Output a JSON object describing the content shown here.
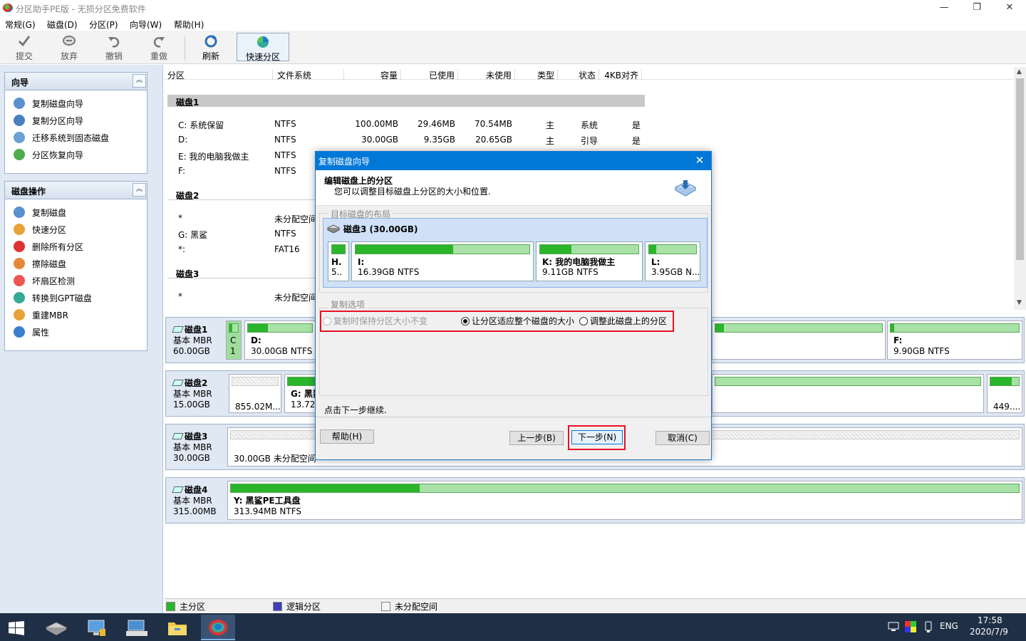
{
  "window": {
    "title": "分区助手PE版 - 无损分区免费软件",
    "minimize": "—",
    "maximize": "❐",
    "close": "✕"
  },
  "menu": [
    "常规(G)",
    "磁盘(D)",
    "分区(P)",
    "向导(W)",
    "帮助(H)"
  ],
  "toolbar": {
    "submit": "提交",
    "discard": "放弃",
    "undo": "撤销",
    "redo": "重做",
    "refresh": "刷新",
    "quick_partition": "快速分区"
  },
  "wizard_panel": {
    "title": "向导",
    "items": [
      "复制磁盘向导",
      "复制分区向导",
      "迁移系统到固态磁盘",
      "分区恢复向导"
    ]
  },
  "disk_ops_panel": {
    "title": "磁盘操作",
    "items": [
      "复制磁盘",
      "快速分区",
      "删除所有分区",
      "擦除磁盘",
      "坏扇区检测",
      "转换到GPT磁盘",
      "重建MBR",
      "属性"
    ]
  },
  "table": {
    "columns": [
      "分区",
      "文件系统",
      "容量",
      "已使用",
      "未使用",
      "类型",
      "状态",
      "4KB对齐"
    ],
    "disk1": {
      "label": "磁盘1",
      "rows": [
        [
          "C: 系统保留",
          "NTFS",
          "100.00MB",
          "29.46MB",
          "70.54MB",
          "主",
          "系统",
          "是"
        ],
        [
          "D:",
          "NTFS",
          "30.00GB",
          "9.35GB",
          "20.65GB",
          "主",
          "引导",
          "是"
        ],
        [
          "E: 我的电脑我做主",
          "NTFS",
          "",
          "",
          "",
          "",
          "",
          ""
        ],
        [
          "F:",
          "NTFS",
          "",
          "",
          "",
          "",
          "",
          ""
        ]
      ]
    },
    "disk2": {
      "label": "磁盘2",
      "rows": [
        [
          "*",
          "未分配空间"
        ],
        [
          "G: 黑鲨",
          "NTFS"
        ],
        [
          "*:",
          "FAT16"
        ]
      ]
    },
    "disk3": {
      "label": "磁盘3",
      "rows": [
        [
          "*",
          "未分配空间"
        ]
      ]
    }
  },
  "disk_map": {
    "disk1": {
      "name": "磁盘1",
      "type": "基本 MBR",
      "size": "60.00GB",
      "parts": [
        "C",
        "1",
        "D:",
        "30.00GB NTFS",
        "F:",
        "9.90GB NTFS"
      ]
    },
    "disk2": {
      "name": "磁盘2",
      "type": "基本 MBR",
      "size": "15.00GB",
      "parts": [
        "855.02M...",
        "G: 黑鲨",
        "13.72G",
        "449...."
      ]
    },
    "disk3": {
      "name": "磁盘3",
      "type": "基本 MBR",
      "size": "30.00GB",
      "parts": [
        "30.00GB 未分配空间"
      ]
    },
    "disk4": {
      "name": "磁盘4",
      "type": "基本 MBR",
      "size": "315.00MB",
      "parts": [
        "Y: 黑鲨PE工具盘",
        "313.94MB NTFS"
      ]
    }
  },
  "legend": [
    "主分区",
    "逻辑分区",
    "未分配空间"
  ],
  "dialog": {
    "title": "复制磁盘向导",
    "heading": "编辑磁盘上的分区",
    "subheading": "您可以调整目标磁盘上分区的大小和位置.",
    "layout_group": "目标磁盘的布局",
    "target_disk": "磁盘3 (30.00GB)",
    "partitions": [
      {
        "letter": "H.",
        "detail": "5..",
        "used": 1.0
      },
      {
        "letter": "I:",
        "detail": "16.39GB NTFS",
        "used": 0.56
      },
      {
        "letter": "K: 我的电脑我做主",
        "detail": "9.11GB NTFS",
        "used": 0.32
      },
      {
        "letter": "L:",
        "detail": "3.95GB N...",
        "used": 0.15
      }
    ],
    "options_group": "复制选项",
    "options": [
      {
        "label": "复制时保持分区大小不变",
        "selected": false,
        "enabled": false
      },
      {
        "label": "让分区适应整个磁盘的大小",
        "selected": true,
        "enabled": true
      },
      {
        "label": "调整此磁盘上的分区",
        "selected": false,
        "enabled": true
      }
    ],
    "hint": "点击下一步继续.",
    "buttons": {
      "help": "帮助(H)",
      "back": "上一步(B)",
      "next": "下一步(N)",
      "cancel": "取消(C)"
    }
  },
  "taskbar": {
    "lang": "ENG",
    "time": "17:58",
    "date": "2020/7/9"
  },
  "colors": {
    "primary_partition": "#2ab52a",
    "logical_partition": "#3f3fb5",
    "dialog_title": "#0078d7",
    "highlight": "#e81123"
  }
}
